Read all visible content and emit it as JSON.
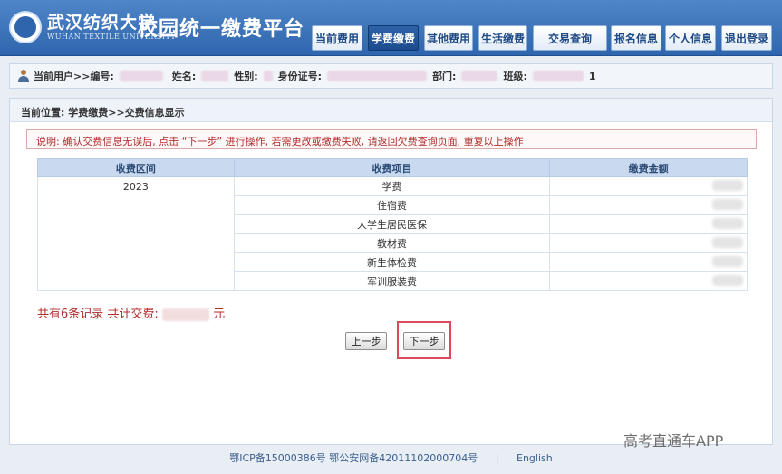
{
  "header": {
    "university_cn": "武汉纺织大学",
    "university_en": "WUHAN TEXTILE UNIVERSITY",
    "platform_title": "校园统一缴费平台",
    "nav": [
      {
        "label": "当前费用",
        "active": false
      },
      {
        "label": "学费缴费",
        "active": true
      },
      {
        "label": "其他费用",
        "active": false
      },
      {
        "label": "生活缴费",
        "active": false
      },
      {
        "label": "交易查询",
        "active": false
      },
      {
        "label": "报名信息",
        "active": false
      },
      {
        "label": "个人信息",
        "active": false
      },
      {
        "label": "退出登录",
        "active": false
      }
    ]
  },
  "userbar": {
    "current_user": "当前用户>>编号:",
    "name_label": "姓名:",
    "gender_label": "性别:",
    "id_label": "身份证号:",
    "dept_label": "部门:",
    "class_label": "班级:",
    "class_suffix": "1"
  },
  "breadcrumb": "当前位置: 学费缴费>>交费信息显示",
  "notice": "说明: 确认交费信息无误后, 点击 “下一步” 进行操作, 若需更改或缴费失败, 请返回欠费查询页面, 重复以上操作",
  "table": {
    "headers": [
      "收费区间",
      "收费项目",
      "缴费金额"
    ],
    "year": "2023",
    "items": [
      "学费",
      "住宿费",
      "大学生居民医保",
      "教材费",
      "新生体检费",
      "军训服装费"
    ]
  },
  "summary": {
    "prefix": "共有6条记录  共计交费:",
    "suffix": "元"
  },
  "buttons": {
    "prev": "上一步",
    "next": "下一步"
  },
  "footer": {
    "icp": "鄂ICP备15000386号 鄂公安网备42011102000704号",
    "separator": "|",
    "language": "English"
  },
  "watermark": "高考直通车APP",
  "colors": {
    "header_blue": "#2f65ad",
    "alert_red": "#b22c2c",
    "highlight_red": "#d94b5a"
  }
}
